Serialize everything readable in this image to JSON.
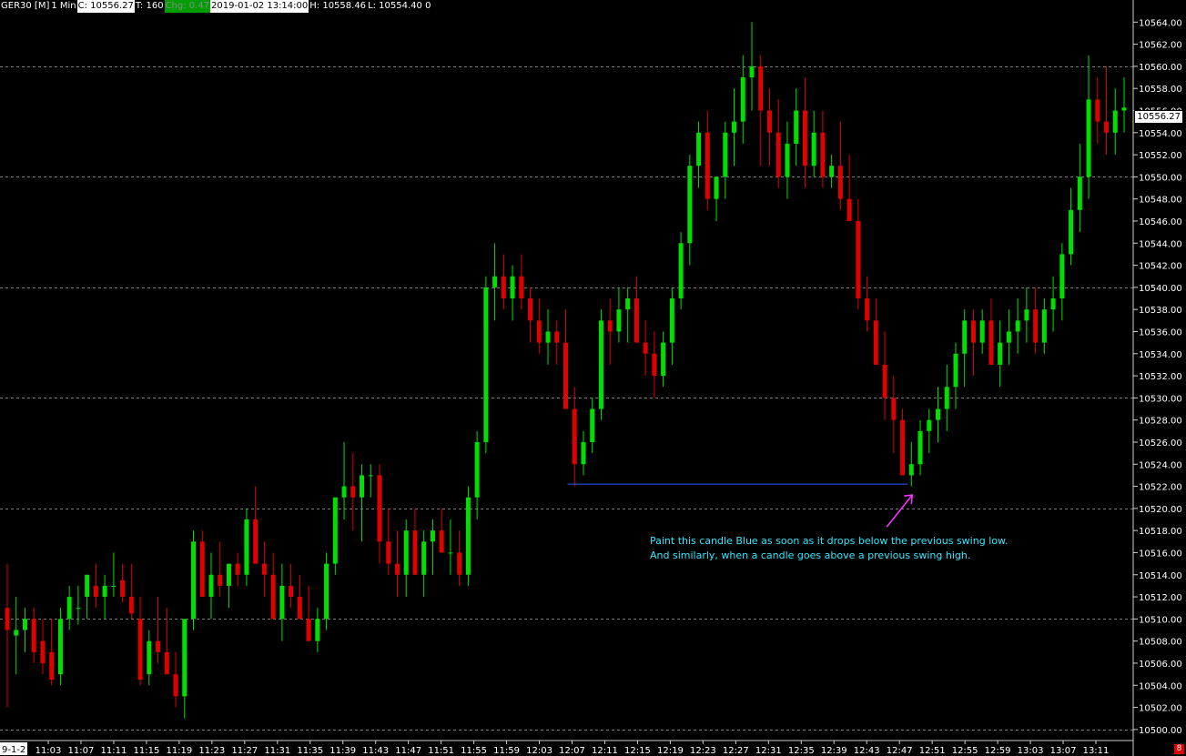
{
  "header": {
    "symbol": "GER30 [M]",
    "timeframe": "1 Min",
    "close_label": "C: 10556.27",
    "ticks_label": "T: 160",
    "change_label": "Chg: 0.47",
    "datetime": "2019-01-02 13:14:00",
    "high_label": "H: 10558.46",
    "low_label": "L: 10554.40 0"
  },
  "last_price": "10556.27",
  "alert_count": "8",
  "first_x_label": "9-1-2",
  "annotation": {
    "line1": "Paint this candle Blue as soon as it drops below the previous swing low.",
    "line2": "And similarly, when a candle goes above a previous swing high."
  },
  "colors": {
    "background": "#000000",
    "up_candle": "#00e000",
    "down_candle": "#e00000",
    "grid": "#7a7a7a",
    "swing_line": "#2a5cff",
    "arrow": "#ff33ff",
    "annotation_text": "#33e8ff"
  },
  "chart_data": {
    "type": "candlestick",
    "grid": true,
    "ylim": [
      10499,
      10566
    ],
    "y_ticks": [
      "10500.00",
      "10502.00",
      "10504.00",
      "10506.00",
      "10508.00",
      "10510.00",
      "10512.00",
      "10514.00",
      "10516.00",
      "10518.00",
      "10520.00",
      "10522.00",
      "10524.00",
      "10526.00",
      "10528.00",
      "10530.00",
      "10532.00",
      "10534.00",
      "10536.00",
      "10538.00",
      "10540.00",
      "10542.00",
      "10544.00",
      "10546.00",
      "10548.00",
      "10550.00",
      "10552.00",
      "10554.00",
      "10556.00",
      "10558.00",
      "10560.00",
      "10562.00",
      "10564.00"
    ],
    "x_ticks": [
      "11:03",
      "11:07",
      "11:11",
      "11:15",
      "11:19",
      "11:23",
      "11:27",
      "11:31",
      "11:35",
      "11:39",
      "11:43",
      "11:47",
      "11:51",
      "11:55",
      "11:59",
      "12:03",
      "12:07",
      "12:11",
      "12:15",
      "12:19",
      "12:23",
      "12:27",
      "12:31",
      "12:35",
      "12:39",
      "12:43",
      "12:47",
      "12:51",
      "12:55",
      "12:59",
      "13:03",
      "13:07",
      "13:11"
    ],
    "candles": [
      [
        10511,
        10515,
        10502,
        10509
      ],
      [
        10508.5,
        10512,
        10505,
        10509
      ],
      [
        10509,
        10511,
        10507,
        10510
      ],
      [
        10510,
        10511,
        10506,
        10507
      ],
      [
        10508,
        10510,
        10505,
        10506
      ],
      [
        10507,
        10510,
        10504,
        10504.5
      ],
      [
        10505,
        10511,
        10504,
        10510
      ],
      [
        10510,
        10513,
        10509,
        10512
      ],
      [
        10511,
        10513,
        10509.5,
        10511
      ],
      [
        10512,
        10514,
        10510,
        10514
      ],
      [
        10513,
        10515,
        10511,
        10512
      ],
      [
        10512,
        10514,
        10510,
        10513
      ],
      [
        10513,
        10516,
        10512,
        10513
      ],
      [
        10513.5,
        10515,
        10511.5,
        10512
      ],
      [
        10512,
        10515,
        10510,
        10510.5
      ],
      [
        10510,
        10512,
        10504,
        10504.5
      ],
      [
        10505,
        10509,
        10504,
        10508
      ],
      [
        10508,
        10512,
        10506,
        10507
      ],
      [
        10507,
        10511,
        10505,
        10505
      ],
      [
        10505,
        10507,
        10502,
        10503
      ],
      [
        10503,
        10510,
        10501,
        10510
      ],
      [
        10510,
        10518,
        10509,
        10517
      ],
      [
        10517,
        10518,
        10512,
        10512
      ],
      [
        10512,
        10516,
        10510,
        10514
      ],
      [
        10514,
        10517,
        10512,
        10513
      ],
      [
        10513,
        10515,
        10511,
        10515
      ],
      [
        10515,
        10516,
        10513,
        10514
      ],
      [
        10514,
        10520,
        10513,
        10519
      ],
      [
        10519,
        10522,
        10515,
        10515
      ],
      [
        10515,
        10517,
        10512,
        10514
      ],
      [
        10514,
        10516,
        10510,
        10510
      ],
      [
        10510,
        10515,
        10508,
        10513
      ],
      [
        10513,
        10515,
        10511,
        10512
      ],
      [
        10512,
        10514,
        10510,
        10510
      ],
      [
        10510,
        10513,
        10508,
        10508
      ],
      [
        10508,
        10511,
        10507,
        10510
      ],
      [
        10510,
        10516,
        10509,
        10515
      ],
      [
        10515,
        10519,
        10514,
        10521
      ],
      [
        10521,
        10526,
        10519,
        10522
      ],
      [
        10522,
        10525,
        10518,
        10521
      ],
      [
        10521,
        10524,
        10517,
        10523
      ],
      [
        10523,
        10524,
        10521,
        10523
      ],
      [
        10523,
        10524,
        10515,
        10517
      ],
      [
        10517,
        10520,
        10514,
        10515
      ],
      [
        10515,
        10518,
        10512,
        10514
      ],
      [
        10514,
        10519,
        10512,
        10518
      ],
      [
        10518,
        10520,
        10514,
        10514
      ],
      [
        10514,
        10518,
        10512,
        10517
      ],
      [
        10517,
        10519,
        10514,
        10518
      ],
      [
        10518,
        10520,
        10516,
        10516
      ],
      [
        10516,
        10519,
        10514,
        10516
      ],
      [
        10516,
        10518,
        10513,
        10514
      ],
      [
        10514,
        10522,
        10513,
        10521
      ],
      [
        10521,
        10527,
        10519,
        10526
      ],
      [
        10526,
        10541,
        10525,
        10540
      ],
      [
        10540,
        10544,
        10537,
        10541
      ],
      [
        10541,
        10543,
        10538,
        10539
      ],
      [
        10539,
        10542,
        10537,
        10541
      ],
      [
        10541,
        10543,
        10538,
        10539
      ],
      [
        10539,
        10540,
        10535,
        10537
      ],
      [
        10537,
        10539,
        10534,
        10535
      ],
      [
        10535,
        10538,
        10533,
        10536
      ],
      [
        10536,
        10537,
        10533,
        10535
      ],
      [
        10535,
        10538,
        10530,
        10529
      ],
      [
        10529,
        10531,
        10522,
        10524
      ],
      [
        10524,
        10527,
        10523,
        10526
      ],
      [
        10526,
        10530,
        10525,
        10529
      ],
      [
        10529,
        10538,
        10528,
        10537
      ],
      [
        10537,
        10539,
        10533,
        10536
      ],
      [
        10536,
        10540,
        10535,
        10538
      ],
      [
        10538,
        10540,
        10535,
        10539
      ],
      [
        10539,
        10541,
        10536,
        10535
      ],
      [
        10535,
        10537,
        10532,
        10534
      ],
      [
        10534,
        10536,
        10530,
        10532
      ],
      [
        10532,
        10536,
        10531,
        10535
      ],
      [
        10535,
        10540,
        10533,
        10539
      ],
      [
        10539,
        10545,
        10538,
        10544
      ],
      [
        10544,
        10552,
        10542,
        10551
      ],
      [
        10551,
        10555,
        10549,
        10554
      ],
      [
        10554,
        10556,
        10547,
        10548
      ],
      [
        10548,
        10550,
        10546,
        10550
      ],
      [
        10550,
        10555,
        10548,
        10554
      ],
      [
        10554,
        10558,
        10551,
        10555
      ],
      [
        10555,
        10561,
        10553,
        10559
      ],
      [
        10559,
        10564,
        10556,
        10560
      ],
      [
        10560,
        10561,
        10551,
        10556
      ],
      [
        10556,
        10558,
        10551,
        10554
      ],
      [
        10554,
        10557,
        10549,
        10550
      ],
      [
        10550,
        10555,
        10548,
        10553
      ],
      [
        10553,
        10558,
        10551,
        10556
      ],
      [
        10556,
        10559,
        10549,
        10551
      ],
      [
        10551,
        10556,
        10550,
        10554
      ],
      [
        10554,
        10556,
        10549,
        10550
      ],
      [
        10550,
        10552,
        10549,
        10551
      ],
      [
        10551,
        10555,
        10547,
        10548
      ],
      [
        10548,
        10552,
        10546,
        10546
      ],
      [
        10546,
        10548,
        10538,
        10539
      ],
      [
        10539,
        10541,
        10536,
        10537
      ],
      [
        10537,
        10539,
        10534,
        10533
      ],
      [
        10533,
        10536,
        10528,
        10530
      ],
      [
        10530,
        10532,
        10525,
        10528
      ],
      [
        10528,
        10529,
        10523,
        10523
      ],
      [
        10523,
        10526,
        10522,
        10524
      ],
      [
        10524,
        10528,
        10523,
        10527
      ],
      [
        10527,
        10529,
        10525,
        10528
      ],
      [
        10528,
        10531,
        10526,
        10529
      ],
      [
        10529,
        10533,
        10527,
        10531
      ],
      [
        10531,
        10535,
        10529,
        10534
      ],
      [
        10534,
        10538,
        10531,
        10537
      ],
      [
        10537,
        10538,
        10532,
        10535
      ],
      [
        10535,
        10538,
        10534,
        10537
      ],
      [
        10537,
        10539,
        10533,
        10533
      ],
      [
        10533,
        10537,
        10531,
        10535
      ],
      [
        10535,
        10538,
        10533,
        10536
      ],
      [
        10536,
        10539,
        10534,
        10537
      ],
      [
        10537,
        10540,
        10535,
        10538
      ],
      [
        10538,
        10540,
        10534,
        10535
      ],
      [
        10535,
        10539,
        10534,
        10538
      ],
      [
        10538,
        10541,
        10536,
        10539
      ],
      [
        10539,
        10544,
        10537,
        10543
      ],
      [
        10543,
        10549,
        10542,
        10547
      ],
      [
        10547,
        10553,
        10545,
        10550
      ],
      [
        10550,
        10561,
        10548,
        10557
      ],
      [
        10557,
        10559,
        10553,
        10555
      ],
      [
        10555,
        10560,
        10552,
        10554
      ],
      [
        10554,
        10558,
        10552,
        10556
      ],
      [
        10556,
        10559,
        10554,
        10556.27
      ]
    ],
    "swing_low_line": {
      "value": 10522.2,
      "from_candle": 63,
      "to_candle": 102
    },
    "annotation_arrow_target_candle": 102
  }
}
